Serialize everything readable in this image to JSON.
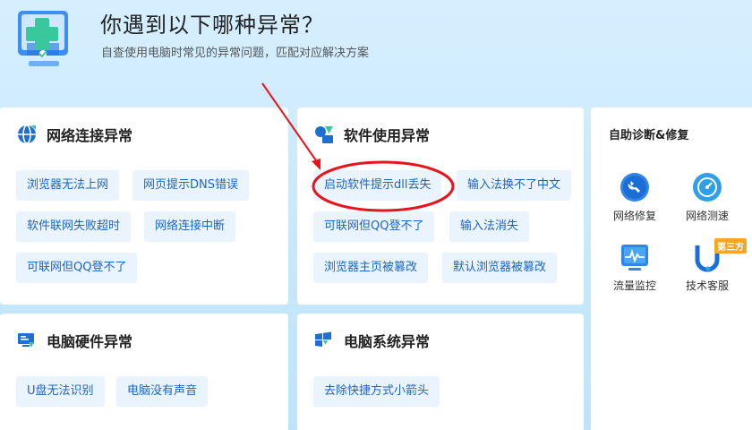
{
  "header": {
    "title": "你遇到以下哪种异常？",
    "subtitle": "自查使用电脑时常见的异常问题，匹配对应解决方案"
  },
  "cards": {
    "network": {
      "title": "网络连接异常",
      "icon": "globe-icon",
      "items": [
        "浏览器无法上网",
        "网页提示DNS错误",
        "软件联网失败超时",
        "网络连接中断",
        "可联网但QQ登不了"
      ]
    },
    "software": {
      "title": "软件使用异常",
      "icon": "software-icon",
      "items": [
        "启动软件提示dll丢失",
        "输入法换不了中文",
        "可联网但QQ登不了",
        "输入法消失",
        "浏览器主页被篡改",
        "默认浏览器被篡改"
      ]
    },
    "hardware": {
      "title": "电脑硬件异常",
      "icon": "hardware-icon",
      "items": [
        "U盘无法识别",
        "电脑没有声音"
      ]
    },
    "system": {
      "title": "电脑系统异常",
      "icon": "windows-icon",
      "items": [
        "去除快捷方式小箭头"
      ]
    }
  },
  "side": {
    "title": "自助诊断&修复",
    "tools": [
      {
        "label": "网络修复",
        "icon": "wrench-icon"
      },
      {
        "label": "网络测速",
        "icon": "speedometer-icon"
      },
      {
        "label": "流量监控",
        "icon": "traffic-monitor-icon"
      },
      {
        "label": "技术客服",
        "icon": "support-icon"
      }
    ],
    "badge": "第三方"
  },
  "colors": {
    "accent": "#1d64c8",
    "tag_bg": "#e9f4ff",
    "annotation_red": "#e8141b"
  }
}
